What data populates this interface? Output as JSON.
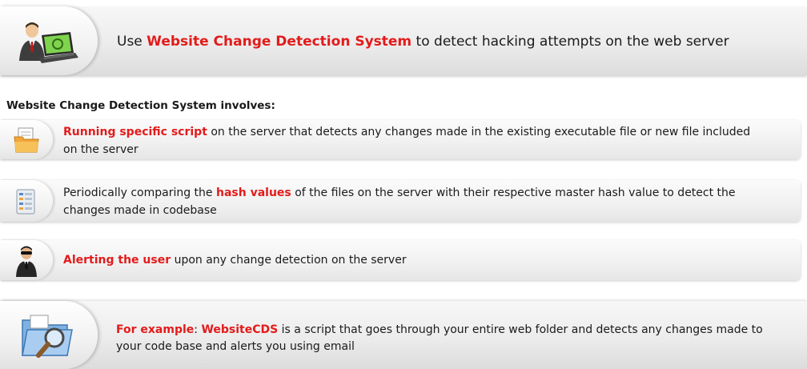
{
  "banner": {
    "pre": "Use ",
    "highlight": "Website Change Detection System",
    "post": " to detect hacking attempts on the web server",
    "icon": "user-laptop-icon"
  },
  "heading": "Website Change Detection System involves:",
  "items": [
    {
      "icon": "folder-files-icon",
      "line1_highlight": "Running specific script",
      "line1_rest": " on the server that detects any changes made in the existing executable file or new file included",
      "line2": "on the server"
    },
    {
      "icon": "document-list-icon",
      "line1_pre": "Periodically comparing the ",
      "line1_highlight": "hash values",
      "line1_rest": " of the files on the server with their respective master hash value to detect the",
      "line2": "changes made in codebase"
    },
    {
      "icon": "agent-icon",
      "line1_highlight": "Alerting the user",
      "line1_rest": " upon any change detection on the server"
    }
  ],
  "example": {
    "icon": "folder-search-icon",
    "label": "For example",
    "colon": ": ",
    "highlight": "WebsiteCDS",
    "line1_rest": " is a script that goes through your entire web folder and detects any changes made to",
    "line2": "your code base and alerts you using email"
  },
  "colors": {
    "highlight": "#e31b1b",
    "text": "#1a1a1a",
    "panel": "#ececec"
  }
}
